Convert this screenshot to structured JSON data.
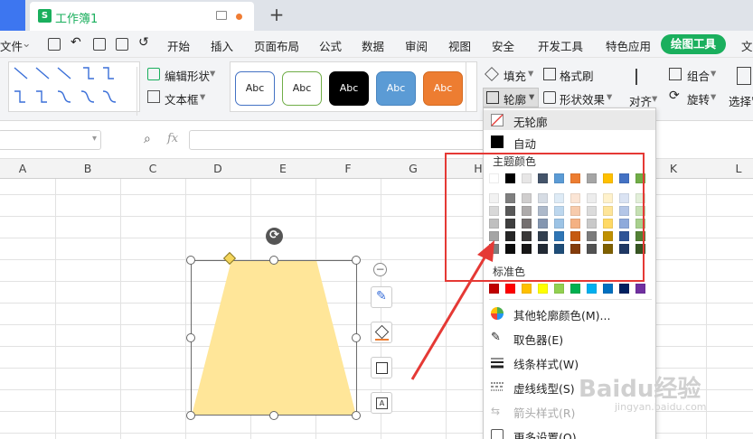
{
  "tabbar": {
    "doc_tab_title": "工作簿1",
    "doc_tab_icon_letter": "S",
    "new_tab_label": "+"
  },
  "menubar": {
    "file_label": "文件",
    "items": [
      "开始",
      "插入",
      "页面布局",
      "公式",
      "数据",
      "审阅",
      "视图",
      "安全",
      "开发工具",
      "特色应用"
    ],
    "active_tab": "绘图工具",
    "overflow_item": "文"
  },
  "ribbon": {
    "edit_shape": "编辑形状",
    "text_box": "文本框",
    "style_label": "Abc",
    "style_swatches": [
      "#ffffff",
      "#ffffff",
      "#000000",
      "#5b9bd5",
      "#ed7d31"
    ],
    "style_borders": [
      "#4472c4",
      "#70ad47",
      "#000000",
      "#5b9bd5",
      "#ed7d31"
    ],
    "fill": "填充",
    "format_brush": "格式刷",
    "outline": "轮廓",
    "shape_effects": "形状效果",
    "align": "对齐",
    "group": "组合",
    "rotate": "旋转",
    "select_pane": "选择窗"
  },
  "formula_bar": {
    "fx_label": "fx"
  },
  "columns": [
    "A",
    "B",
    "C",
    "D",
    "E",
    "F",
    "G",
    "H",
    "I",
    "J",
    "K",
    "L"
  ],
  "dropdown": {
    "no_outline": "无轮廓",
    "auto": "自动",
    "theme_colors_label": "主题颜色",
    "theme_top_row": [
      "#ffffff",
      "#000000",
      "#e7e6e6",
      "#44546a",
      "#5b9bd5",
      "#ed7d31",
      "#a5a5a5",
      "#ffc000",
      "#4472c4",
      "#70ad47"
    ],
    "theme_shades": [
      [
        "#f2f2f2",
        "#7f7f7f",
        "#d0cece",
        "#d6dce4",
        "#deebf6",
        "#fbe5d5",
        "#ededed",
        "#fff2cc",
        "#dae3f3",
        "#e2efd9"
      ],
      [
        "#d8d8d8",
        "#595959",
        "#aeabab",
        "#adb9ca",
        "#bdd7ee",
        "#f7cbac",
        "#dbdbdb",
        "#fee599",
        "#b4c6e7",
        "#c5e0b3"
      ],
      [
        "#bfbfbf",
        "#3f3f3f",
        "#757070",
        "#8496b0",
        "#9cc3e5",
        "#f4b183",
        "#c9c9c9",
        "#ffd965",
        "#8eaadb",
        "#a8d08d"
      ],
      [
        "#a5a5a5",
        "#262626",
        "#3a3838",
        "#323f4f",
        "#2e75b5",
        "#c55a11",
        "#7b7b7b",
        "#bf9000",
        "#2f5496",
        "#538135"
      ],
      [
        "#7f7f7f",
        "#0c0c0c",
        "#171616",
        "#222a35",
        "#1e4d78",
        "#843c0b",
        "#525252",
        "#7f6000",
        "#1f3864",
        "#375623"
      ]
    ],
    "standard_colors_label": "标准色",
    "standard_colors": [
      "#c00000",
      "#ff0000",
      "#ffc000",
      "#ffff00",
      "#92d050",
      "#00b050",
      "#00b0f0",
      "#0070c0",
      "#002060",
      "#7030a0"
    ],
    "more_colors": "其他轮廓颜色(M)...",
    "eyedropper": "取色器(E)",
    "line_style": "线条样式(W)",
    "dash_type": "虚线线型(S)",
    "arrow_style": "箭头样式(R)",
    "more_settings": "更多设置(O)"
  },
  "colors": {
    "shape_fill": "#ffe699",
    "wps_green": "#1aaf5d",
    "annotation_red": "#e53935"
  },
  "watermark": {
    "brand": "Baidu经验",
    "url": "jingyan.baidu.com"
  }
}
